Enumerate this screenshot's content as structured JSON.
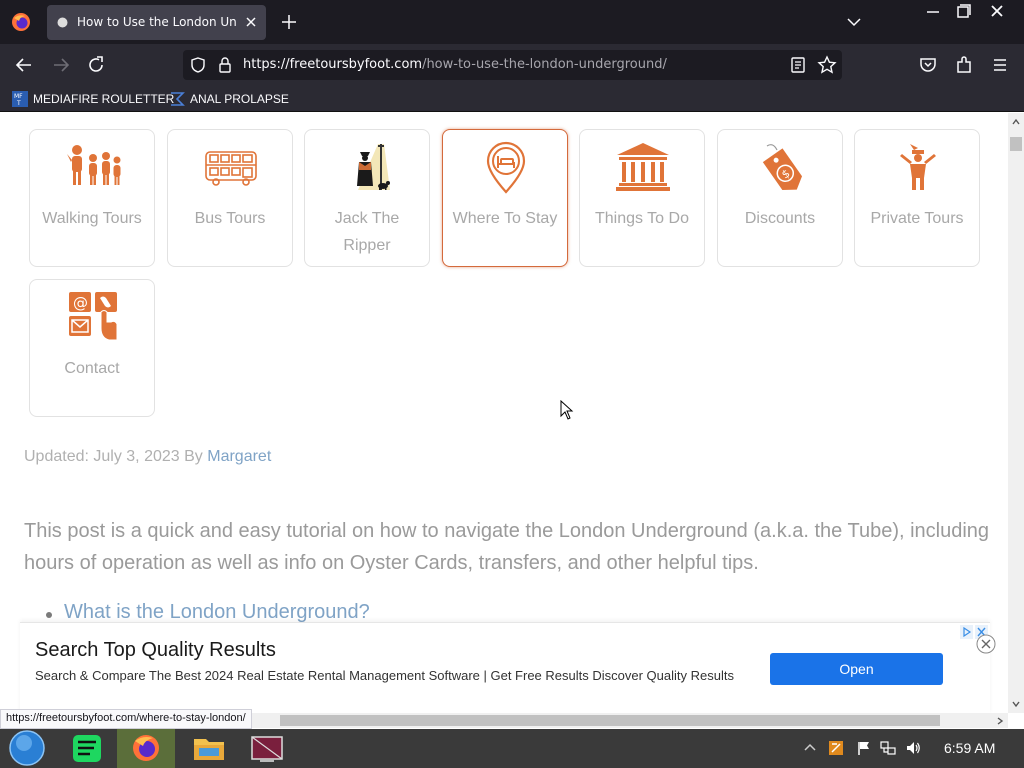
{
  "browser": {
    "tab_title": "How to Use the London Underground",
    "url_host": "https://freetoursbyfoot.com",
    "url_path": "/how-to-use-the-london-underground/",
    "status_url": "https://freetoursbyfoot.com/where-to-stay-london/"
  },
  "bookmarks": [
    {
      "label": "MEDIAFIRE ROULETTER"
    },
    {
      "label": "ANAL PROLAPSE"
    }
  ],
  "categories": [
    {
      "label": "Walking Tours",
      "icon": "walking-group-icon"
    },
    {
      "label": "Bus Tours",
      "icon": "bus-icon"
    },
    {
      "label": "Jack The Ripper",
      "icon": "lamppost-silhouette-icon"
    },
    {
      "label": "Where To Stay",
      "icon": "bed-pin-icon",
      "active": true
    },
    {
      "label": "Things To Do",
      "icon": "museum-icon"
    },
    {
      "label": "Discounts",
      "icon": "price-tag-icon"
    },
    {
      "label": "Private Tours",
      "icon": "tour-guide-icon"
    },
    {
      "label": "Contact",
      "icon": "contact-icon"
    }
  ],
  "article": {
    "updated_prefix": "Updated: July 3, 2023 By",
    "author": "Margaret",
    "intro": "This post is a quick and easy tutorial on how to navigate the London Underground (a.k.a. the Tube), including hours of operation as well as info on Oyster Cards, transfers, and other helpful tips.",
    "toc_first": "What is the London Underground?"
  },
  "ad": {
    "title": "Search Top Quality Results",
    "description": "Search & Compare The Best 2024 Real Estate Rental Management Software | Get Free Results Discover Quality Results",
    "button": "Open"
  },
  "taskbar": {
    "clock": "6:59 AM"
  },
  "colors": {
    "accent": "#d46a3c",
    "link": "#7fa3c6",
    "ad_button": "#1a73e8"
  }
}
